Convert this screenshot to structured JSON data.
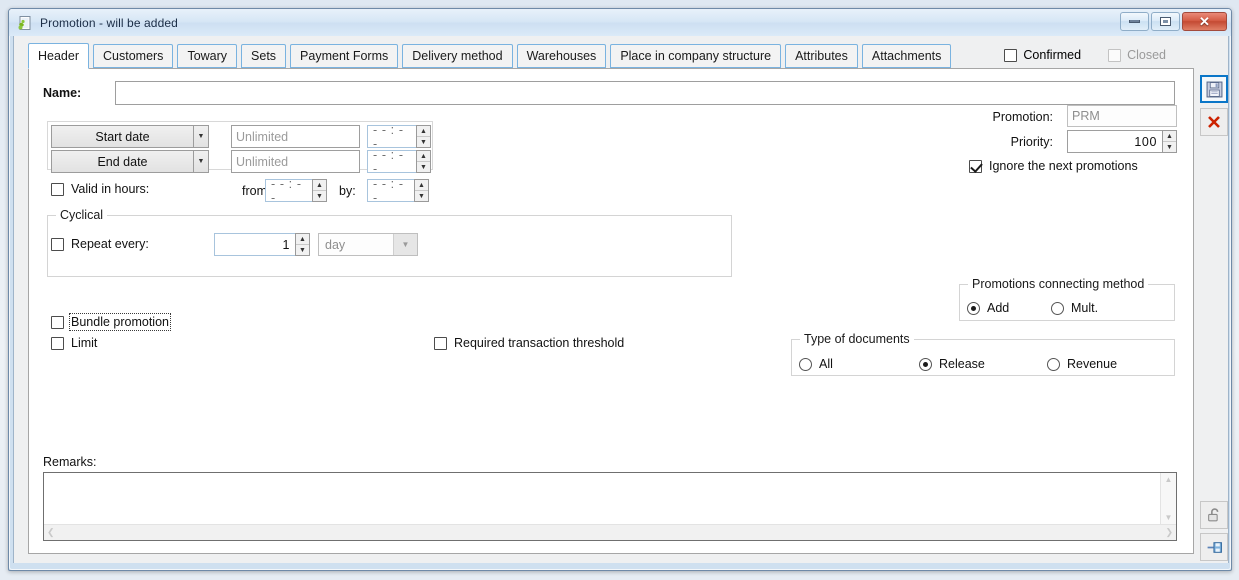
{
  "window": {
    "title": "Promotion - will be added",
    "icon": "app-window-icon",
    "controls": {
      "minimize": "minimize",
      "restore": "restore",
      "close": "close"
    }
  },
  "tabs": [
    {
      "label": "Header",
      "active": true
    },
    {
      "label": "Customers",
      "active": false
    },
    {
      "label": "Towary",
      "active": false
    },
    {
      "label": "Sets",
      "active": false
    },
    {
      "label": "Payment Forms",
      "active": false
    },
    {
      "label": "Delivery method",
      "active": false
    },
    {
      "label": "Warehouses",
      "active": false
    },
    {
      "label": "Place in company structure",
      "active": false
    },
    {
      "label": "Attributes",
      "active": false
    },
    {
      "label": "Attachments",
      "active": false
    }
  ],
  "flags": {
    "confirmed": {
      "label": "Confirmed",
      "checked": false,
      "enabled": true
    },
    "closed": {
      "label": "Closed",
      "checked": false,
      "enabled": false
    }
  },
  "form": {
    "name": {
      "label": "Name:",
      "value": "",
      "placeholder": ""
    },
    "start_date": {
      "button": "Start date",
      "value": "",
      "placeholder": "Unlimited",
      "time": "- - : - -"
    },
    "end_date": {
      "button": "End date",
      "value": "",
      "placeholder": "Unlimited",
      "time": "- - : - -"
    },
    "valid_in_hours": {
      "label": "Valid in hours:",
      "checked": false,
      "from_label": "from",
      "from_time": "- - : - -",
      "by_label": "by:",
      "by_time": "- - : - -"
    },
    "cyclical": {
      "title": "Cyclical",
      "repeat_label": "Repeat every:",
      "repeat_checked": false,
      "repeat_value": "1",
      "unit_value": "day"
    },
    "bundle_promotion": {
      "label": "Bundle promotion",
      "checked": false,
      "focused": true
    },
    "limit": {
      "label": "Limit",
      "checked": false
    },
    "required_threshold": {
      "label": "Required transaction threshold",
      "checked": false
    },
    "remarks": {
      "label": "Remarks:",
      "value": ""
    }
  },
  "right": {
    "promotion": {
      "label": "Promotion:",
      "value": "PRM",
      "enabled": false
    },
    "priority": {
      "label": "Priority:",
      "value": "100"
    },
    "ignore_next": {
      "label": "Ignore the next promotions",
      "checked": true
    },
    "connecting_method": {
      "title": "Promotions connecting method",
      "options": [
        {
          "label": "Add",
          "selected": true
        },
        {
          "label": "Mult.",
          "selected": false
        }
      ]
    },
    "type_of_documents": {
      "title": "Type of documents",
      "options": [
        {
          "label": "All",
          "selected": false
        },
        {
          "label": "Release",
          "selected": true
        },
        {
          "label": "Revenue",
          "selected": false
        }
      ]
    }
  },
  "toolbar": [
    {
      "name": "save-button",
      "icon": "floppy-disk-icon",
      "focused": true
    },
    {
      "name": "cancel-button",
      "icon": "red-x-icon",
      "focused": false
    },
    {
      "name": "unlock-button",
      "icon": "open-padlock-icon",
      "focused": false
    },
    {
      "name": "pin-button",
      "icon": "pin-save-icon",
      "focused": false
    }
  ],
  "colors": {
    "accent": "#0a76c8",
    "tab_border": "#7ab3e0",
    "close_button": "#c44a33",
    "panel_bg": "#ffffff"
  }
}
